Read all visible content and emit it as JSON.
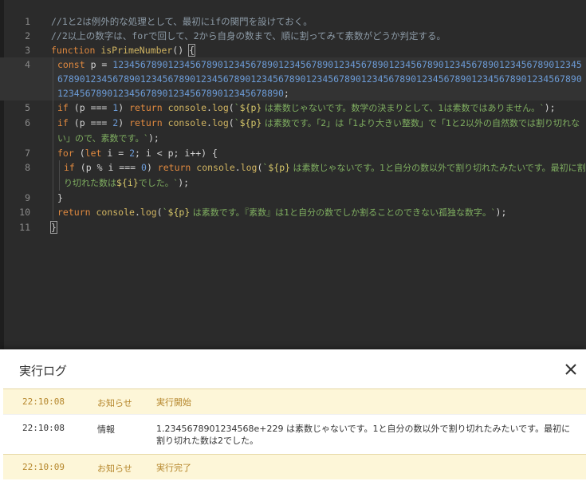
{
  "editor": {
    "line_numbers": [
      "1",
      "2",
      "3",
      "4",
      "5",
      "6",
      "7",
      "8",
      "9",
      "10",
      "11"
    ],
    "lines": [
      "//1と2は例外的な処理として、最初にifの関門を設けておく。",
      "//2以上の数字は、forで回して、2から自身の数まで、順に割ってみて素数がどうか判定する。",
      "function isPrimeNumber() {",
      "const p = 12345678901234567890123456789012345678901234567890123456789012345678901234567890123456789012345678901234567890123456789012345678901234567890123456789012345678901234567890123456789012345678901234567890123456789012345678890;",
      "if (p === 1) return console.log(`${p} は素数じゃないです。数学の決まりとして、1は素数ではありません。`);",
      "if (p === 2) return console.log(`${p} は素数です。「2」は「1より大きい整数」で「1と2以外の自然数では割り切れない」ので、素数です。`);",
      "for (let i = 2; i < p; i++) {",
      "if (p % i === 0) return console.log(`${p} は素数じゃないです。1と自分の数以外で割り切れたみたいです。最初に割り切れた数は${i}でした。`);",
      "}",
      "return console.log(`${p} は素数です。『素数』は1と自分の数でしか割ることのできない孤独な数字。`);",
      "}"
    ]
  },
  "log_panel": {
    "title": "実行ログ",
    "close_icon": "close-icon",
    "entries": [
      {
        "time": "22:10:08",
        "level": "お知らせ",
        "message": "実行開始"
      },
      {
        "time": "22:10:08",
        "level": "情報",
        "message": "1.2345678901234568e+229 は素数じゃないです。1と自分の数以外で割り切れたみたいです。最初に割り切れた数は2でした。"
      },
      {
        "time": "22:10:09",
        "level": "お知らせ",
        "message": "実行完了"
      }
    ]
  },
  "colors": {
    "editor_bg": "#2b2b2b",
    "keyword": "#e0893f",
    "function_name": "#d0b461",
    "number": "#6c9bd6",
    "string": "#7fae60",
    "comment": "#8c9aa6",
    "notice_bg": "#fdf6d8",
    "notice_text": "#b5862b"
  }
}
